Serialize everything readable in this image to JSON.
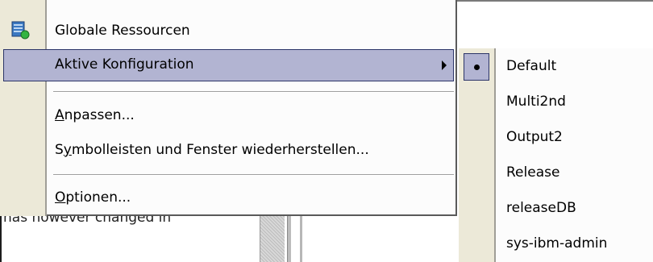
{
  "background": {
    "obscured_text": "has however changed in"
  },
  "menu": {
    "items": [
      {
        "label": "Globale Ressourcen",
        "icon": "global-resources-icon",
        "accel": ""
      },
      {
        "label": "Aktive Konfiguration",
        "has_submenu": true
      },
      {
        "label_accel": "A",
        "label_rest": "npassen..."
      },
      {
        "label_pre": "S",
        "label_accel": "y",
        "label_rest": "mbolleisten und Fenster wiederherstellen..."
      },
      {
        "label_accel": "O",
        "label_rest": "ptionen..."
      }
    ]
  },
  "submenu": {
    "selected": "Default",
    "items": [
      {
        "label": "Default"
      },
      {
        "label": "Multi2nd"
      },
      {
        "label": "Output2"
      },
      {
        "label": "Release"
      },
      {
        "label": "releaseDB"
      },
      {
        "label": "sys-ibm-admin"
      }
    ]
  },
  "colors": {
    "highlight": "#b2b4d2",
    "highlight_border": "#2c3568",
    "gutter": "#ece9d8"
  }
}
